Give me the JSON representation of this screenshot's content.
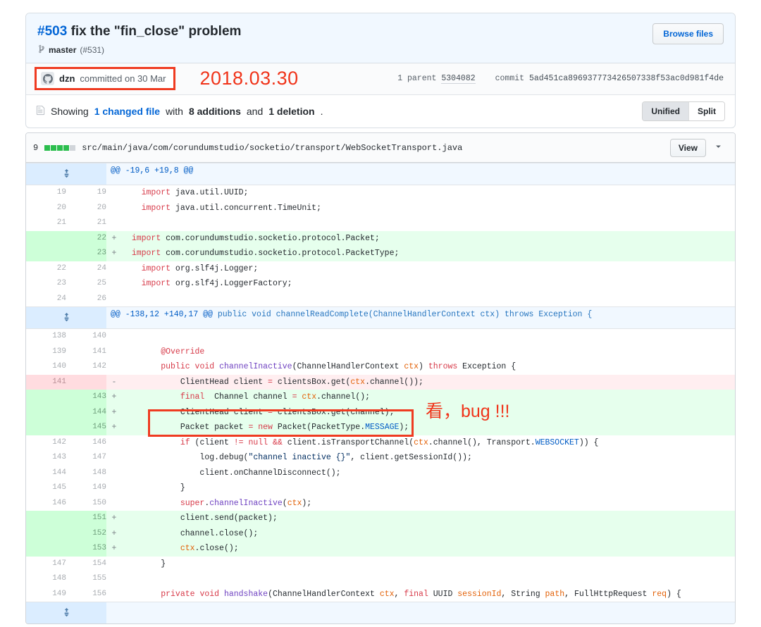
{
  "commit": {
    "number": "#503",
    "title": "fix the \"fin_close\" problem",
    "branch_icon": "git-branch-icon",
    "branch": "master",
    "pull_request": "(#531)",
    "browse_files_label": "Browse files",
    "author": "dzn",
    "committed_text": "committed on 30 Mar",
    "parent_label": "1 parent",
    "parent_hash": "5304082",
    "commit_label": "commit",
    "commit_hash": "5ad451ca896937773426507338f53ac0d981f4de"
  },
  "summary": {
    "file_icon": "file-icon",
    "prefix": "Showing",
    "changed_files": "1 changed file",
    "with": "with",
    "additions": "8 additions",
    "and": "and",
    "deletions": "1 deletion",
    "period": ".",
    "view_unified": "Unified",
    "view_split": "Split"
  },
  "file": {
    "change_count": "9",
    "stat_blocks": [
      "g",
      "g",
      "g",
      "g",
      "n"
    ],
    "path": "src/main/java/com/corundumstudio/socketio/transport/WebSocketTransport.java",
    "view_label": "View",
    "chevron_icon": "chevron-down-icon"
  },
  "annotations": {
    "date_overlay": "2018.03.30",
    "bug_note": "看，bug !!!",
    "box_color": "#ef3b21"
  },
  "diff": {
    "expander_icon": "unfold-icon",
    "rows": [
      {
        "type": "hunk",
        "old": "",
        "new": "",
        "mark": "",
        "code": "@@ -19,6 +19,8 @@"
      },
      {
        "type": "ctx",
        "old": "19",
        "new": "19",
        "mark": "",
        "code": "    import java.util.UUID;"
      },
      {
        "type": "ctx",
        "old": "20",
        "new": "20",
        "mark": "",
        "code": "    import java.util.concurrent.TimeUnit;"
      },
      {
        "type": "ctx",
        "old": "21",
        "new": "21",
        "mark": "",
        "code": ""
      },
      {
        "type": "add",
        "old": "",
        "new": "22",
        "mark": "+",
        "code": "  import com.corundumstudio.socketio.protocol.Packet;"
      },
      {
        "type": "add",
        "old": "",
        "new": "23",
        "mark": "+",
        "code": "  import com.corundumstudio.socketio.protocol.PacketType;"
      },
      {
        "type": "ctx",
        "old": "22",
        "new": "24",
        "mark": "",
        "code": "    import org.slf4j.Logger;"
      },
      {
        "type": "ctx",
        "old": "23",
        "new": "25",
        "mark": "",
        "code": "    import org.slf4j.LoggerFactory;"
      },
      {
        "type": "ctx",
        "old": "24",
        "new": "26",
        "mark": "",
        "code": ""
      },
      {
        "type": "hunk",
        "old": "",
        "new": "",
        "mark": "",
        "code": "@@ -138,12 +140,17 @@ public void channelReadComplete(ChannelHandlerContext ctx) throws Exception {"
      },
      {
        "type": "ctx",
        "old": "138",
        "new": "140",
        "mark": "",
        "code": ""
      },
      {
        "type": "ctx",
        "old": "139",
        "new": "141",
        "mark": "",
        "code": "        @Override"
      },
      {
        "type": "ctx",
        "old": "140",
        "new": "142",
        "mark": "",
        "code": "        public void channelInactive(ChannelHandlerContext ctx) throws Exception {"
      },
      {
        "type": "del",
        "old": "141",
        "new": "",
        "mark": "-",
        "code": "            ClientHead client = clientsBox.get(ctx.channel());"
      },
      {
        "type": "add",
        "old": "",
        "new": "143",
        "mark": "+",
        "code": "            final  Channel channel = ctx.channel();"
      },
      {
        "type": "add",
        "old": "",
        "new": "144",
        "mark": "+",
        "code": "            ClientHead client = clientsBox.get(channel);"
      },
      {
        "type": "add",
        "old": "",
        "new": "145",
        "mark": "+",
        "code": "            Packet packet = new Packet(PacketType.MESSAGE);"
      },
      {
        "type": "ctx",
        "old": "142",
        "new": "146",
        "mark": "",
        "code": "            if (client != null && client.isTransportChannel(ctx.channel(), Transport.WEBSOCKET)) {"
      },
      {
        "type": "ctx",
        "old": "143",
        "new": "147",
        "mark": "",
        "code": "                log.debug(\"channel inactive {}\", client.getSessionId());"
      },
      {
        "type": "ctx",
        "old": "144",
        "new": "148",
        "mark": "",
        "code": "                client.onChannelDisconnect();"
      },
      {
        "type": "ctx",
        "old": "145",
        "new": "149",
        "mark": "",
        "code": "            }"
      },
      {
        "type": "ctx",
        "old": "146",
        "new": "150",
        "mark": "",
        "code": "            super.channelInactive(ctx);"
      },
      {
        "type": "add",
        "old": "",
        "new": "151",
        "mark": "+",
        "code": "            client.send(packet);"
      },
      {
        "type": "add",
        "old": "",
        "new": "152",
        "mark": "+",
        "code": "            channel.close();"
      },
      {
        "type": "add",
        "old": "",
        "new": "153",
        "mark": "+",
        "code": "            ctx.close();"
      },
      {
        "type": "ctx",
        "old": "147",
        "new": "154",
        "mark": "",
        "code": "        }"
      },
      {
        "type": "ctx",
        "old": "148",
        "new": "155",
        "mark": "",
        "code": ""
      },
      {
        "type": "ctx",
        "old": "149",
        "new": "156",
        "mark": "",
        "code": "        private void handshake(ChannelHandlerContext ctx, final UUID sessionId, String path, FullHttpRequest req) {"
      }
    ]
  }
}
